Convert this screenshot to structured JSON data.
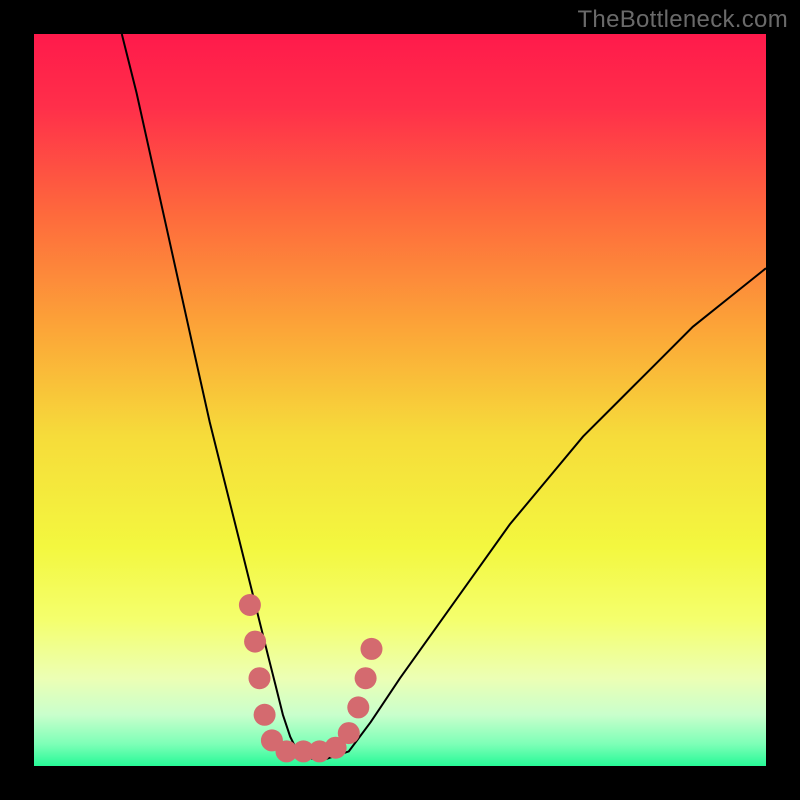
{
  "watermark": "TheBottleneck.com",
  "chart_data": {
    "type": "line",
    "title": "",
    "xlabel": "",
    "ylabel": "",
    "xlim": [
      0,
      100
    ],
    "ylim": [
      0,
      100
    ],
    "gradient_stops": [
      {
        "offset": 0.0,
        "color": "#ff1a4b"
      },
      {
        "offset": 0.1,
        "color": "#ff2f4a"
      },
      {
        "offset": 0.25,
        "color": "#fe6b3c"
      },
      {
        "offset": 0.4,
        "color": "#fca438"
      },
      {
        "offset": 0.55,
        "color": "#f6dc3a"
      },
      {
        "offset": 0.7,
        "color": "#f3f73f"
      },
      {
        "offset": 0.8,
        "color": "#f4ff6d"
      },
      {
        "offset": 0.88,
        "color": "#ecffb4"
      },
      {
        "offset": 0.93,
        "color": "#c9ffcc"
      },
      {
        "offset": 0.97,
        "color": "#7dffb7"
      },
      {
        "offset": 1.0,
        "color": "#27f997"
      }
    ],
    "series": [
      {
        "name": "bottleneck-curve",
        "color": "#000000",
        "width": 2,
        "x": [
          12,
          14,
          16,
          18,
          20,
          22,
          24,
          26,
          28,
          30,
          31,
          32,
          33,
          34,
          35,
          36,
          38,
          40,
          43,
          46,
          50,
          55,
          60,
          65,
          70,
          75,
          80,
          85,
          90,
          95,
          100
        ],
        "y": [
          100,
          92,
          83,
          74,
          65,
          56,
          47,
          39,
          31,
          23,
          19,
          15,
          11,
          7,
          4,
          2,
          1,
          1,
          2,
          6,
          12,
          19,
          26,
          33,
          39,
          45,
          50,
          55,
          60,
          64,
          68
        ]
      }
    ],
    "markers": {
      "name": "highlight-cluster",
      "color": "#d46a6f",
      "radius": 11,
      "points": [
        {
          "x": 29.5,
          "y": 22
        },
        {
          "x": 30.2,
          "y": 17
        },
        {
          "x": 30.8,
          "y": 12
        },
        {
          "x": 31.5,
          "y": 7
        },
        {
          "x": 32.5,
          "y": 3.5
        },
        {
          "x": 34.5,
          "y": 2
        },
        {
          "x": 36.8,
          "y": 2
        },
        {
          "x": 39.0,
          "y": 2
        },
        {
          "x": 41.2,
          "y": 2.5
        },
        {
          "x": 43.0,
          "y": 4.5
        },
        {
          "x": 44.3,
          "y": 8
        },
        {
          "x": 45.3,
          "y": 12
        },
        {
          "x": 46.1,
          "y": 16
        }
      ]
    }
  }
}
